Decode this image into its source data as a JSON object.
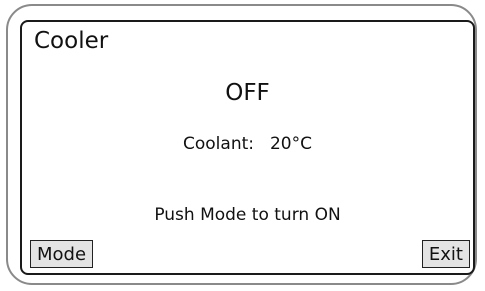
{
  "screen": {
    "title": "Cooler",
    "state": "OFF",
    "coolant_label": "Coolant:",
    "coolant_value": "20°C",
    "hint": "Push Mode to turn ON"
  },
  "softkeys": {
    "left_label": "Mode",
    "right_label": "Exit"
  },
  "colors": {
    "screen_background": "#ffffff",
    "button_background": "#e4e4e4",
    "text": "#111111"
  }
}
